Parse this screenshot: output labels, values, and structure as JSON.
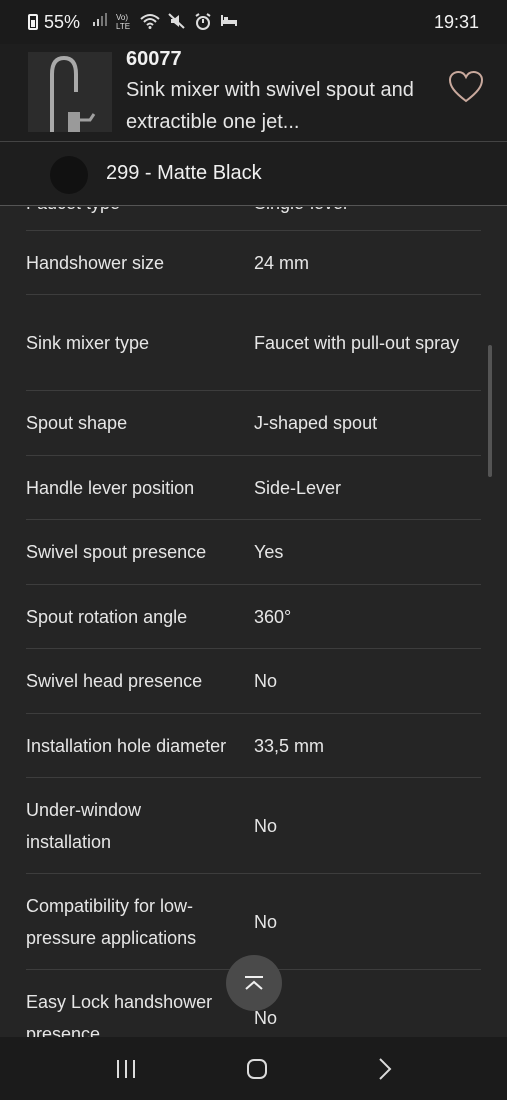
{
  "status_bar": {
    "battery": "55%",
    "signal_text": "Vo) LTE",
    "time": "19:31"
  },
  "product": {
    "code": "60077",
    "name": "Sink mixer with swivel spout and extractible one jet..."
  },
  "finish": {
    "label": "299 - Matte Black",
    "swatch_color": "#111111"
  },
  "specs": [
    {
      "label": "Faucet type",
      "value": "Single-lever"
    },
    {
      "label": "Handshower size",
      "value": "24 mm"
    },
    {
      "label": "Sink mixer type",
      "value": "Faucet with pull-out spray"
    },
    {
      "label": "Spout shape",
      "value": "J-shaped spout"
    },
    {
      "label": "Handle lever position",
      "value": "Side-Lever"
    },
    {
      "label": "Swivel spout presence",
      "value": "Yes"
    },
    {
      "label": "Spout rotation angle",
      "value": "360°"
    },
    {
      "label": "Swivel head presence",
      "value": "No"
    },
    {
      "label": "Installation hole diameter",
      "value": "33,5 mm"
    },
    {
      "label": "Under-window installation",
      "value": "No"
    },
    {
      "label": "Compatibility for low-pressure applications",
      "value": "No"
    },
    {
      "label": "Easy Lock handshower presence",
      "value": "No"
    }
  ],
  "icons": {
    "favorite": "heart-icon",
    "back_to_top": "arrow-up-to-top-icon",
    "nav_recents": "recents-icon",
    "nav_home": "home-icon",
    "nav_back": "back-icon"
  }
}
